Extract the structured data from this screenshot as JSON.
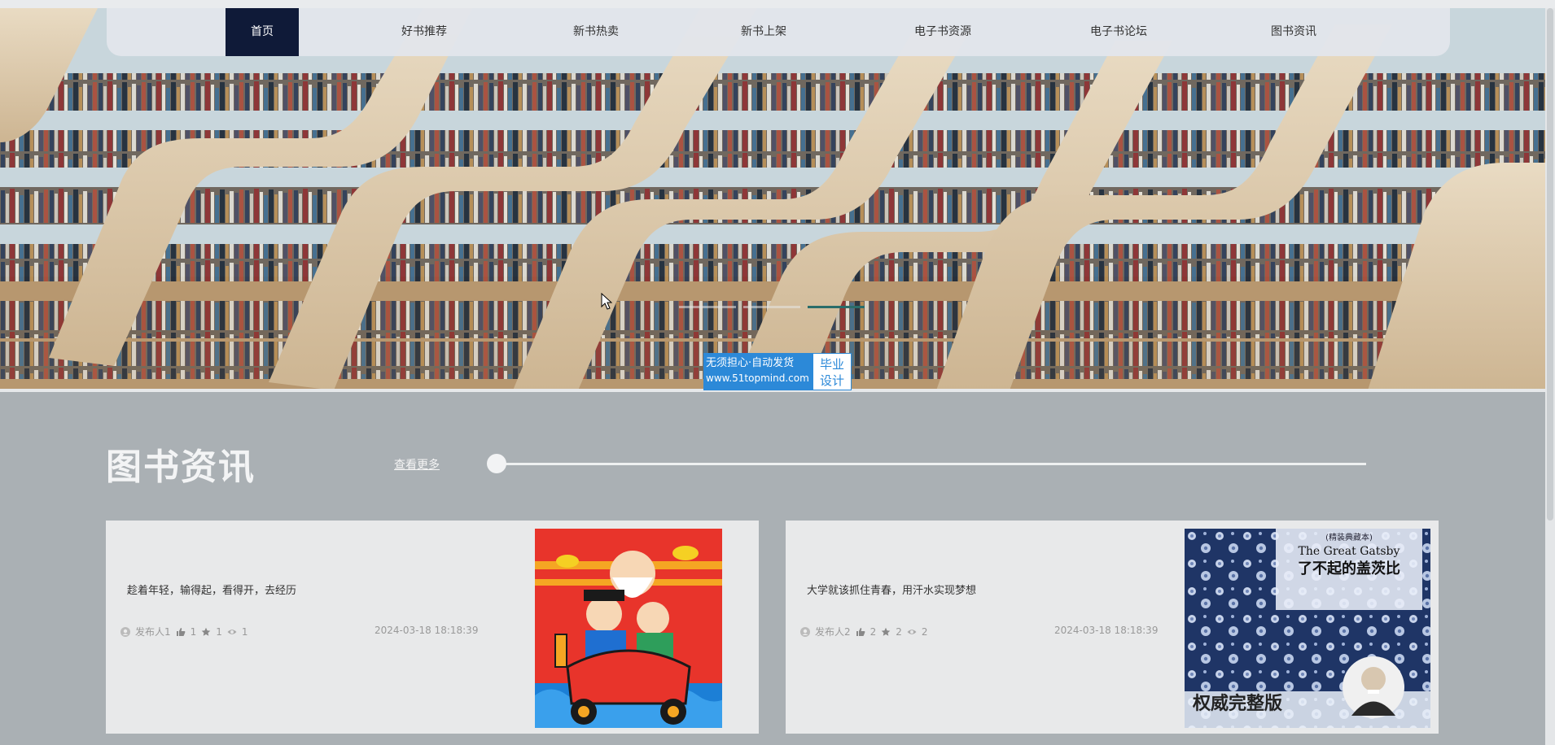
{
  "nav": {
    "items": [
      "首页",
      "好书推荐",
      "新书热卖",
      "新书上架",
      "电子书资源",
      "电子书论坛",
      "图书资讯"
    ],
    "active_index": 0
  },
  "watermark": {
    "line1": "无须担心·自动发货",
    "line2": "www.51topmind.com",
    "badge_line1": "毕业",
    "badge_line2": "设计"
  },
  "carousel": {
    "slide_count": 3,
    "active_index": 2
  },
  "section": {
    "title": "图书资讯",
    "more_label": "查看更多"
  },
  "news": [
    {
      "text": "趁着年轻，输得起，看得开，去经历",
      "author": "发布人1",
      "likes": "1",
      "favorites": "1",
      "views": "1",
      "date": "2024-03-18 18:18:39",
      "image_label": ""
    },
    {
      "text": "大学就该抓住青春，用汗水实现梦想",
      "author": "发布人2",
      "likes": "2",
      "favorites": "2",
      "views": "2",
      "date": "2024-03-18 18:18:39",
      "image_label": "",
      "cover": {
        "tag": "(精装典藏本)",
        "en_title": "The Great Gatsby",
        "cn_title": "了不起的盖茨比",
        "banner": "权威完整版"
      }
    }
  ],
  "colors": {
    "nav_active": "#0f1a38",
    "page_bg": "#aab0b4",
    "card_bg": "#e8e9ea",
    "slider_active": "#2a6d6a"
  }
}
